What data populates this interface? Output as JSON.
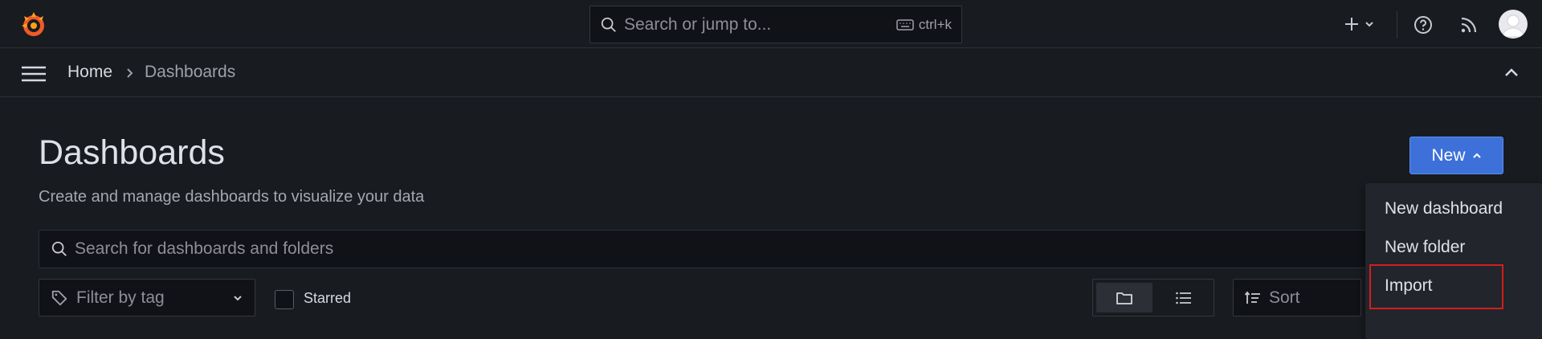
{
  "topbar": {
    "search_placeholder": "Search or jump to...",
    "shortcut": "ctrl+k"
  },
  "breadcrumb": {
    "home": "Home",
    "current": "Dashboards"
  },
  "page": {
    "title": "Dashboards",
    "subtitle": "Create and manage dashboards to visualize your data"
  },
  "new_button": {
    "label": "New"
  },
  "dashboard_search": {
    "placeholder": "Search for dashboards and folders"
  },
  "filter": {
    "placeholder": "Filter by tag"
  },
  "starred": {
    "label": "Starred"
  },
  "sort": {
    "placeholder": "Sort"
  },
  "dropdown": {
    "items": [
      {
        "label": "New dashboard"
      },
      {
        "label": "New folder"
      },
      {
        "label": "Import"
      }
    ]
  },
  "colors": {
    "background": "#181b1f",
    "primary": "#3d71d9",
    "highlight": "#d21f1f",
    "logo": "#f05a28"
  },
  "icons": [
    "grafana-logo-icon",
    "search-icon",
    "keyboard-icon",
    "plus-icon",
    "chevron-down-icon",
    "help-icon",
    "rss-icon",
    "avatar",
    "menu-icon",
    "chevron-right-icon",
    "chevron-up-icon",
    "tag-icon",
    "folder-icon",
    "list-icon",
    "sort-icon"
  ]
}
